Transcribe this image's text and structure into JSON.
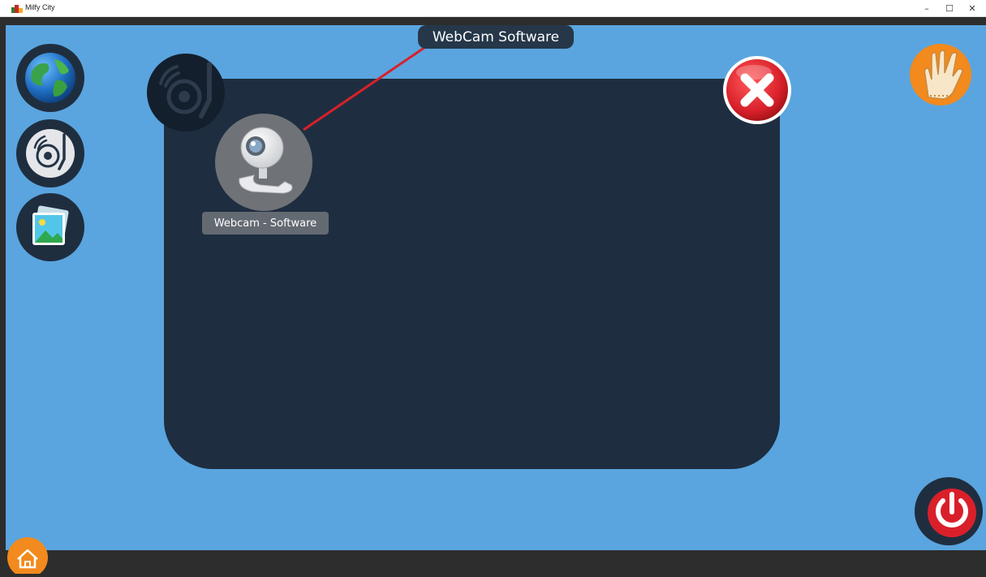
{
  "window": {
    "title": "Milfy City",
    "minimize_glyph": "–",
    "maximize_glyph": "☐",
    "close_glyph": "✕"
  },
  "tooltip": {
    "text": "WebCam Software"
  },
  "panel": {
    "apps": [
      {
        "label": "Webcam - Software",
        "icon": "webcam-icon"
      }
    ]
  },
  "dock": {
    "items": [
      {
        "icon": "globe-icon"
      },
      {
        "icon": "music-disc-icon"
      },
      {
        "icon": "gallery-icon"
      }
    ]
  },
  "colors": {
    "desktop": "#5aa5df",
    "panel": "#1e2e40",
    "taskbar": "#2d2d2d",
    "accent_red": "#d9202a",
    "accent_orange": "#f28a1d"
  }
}
